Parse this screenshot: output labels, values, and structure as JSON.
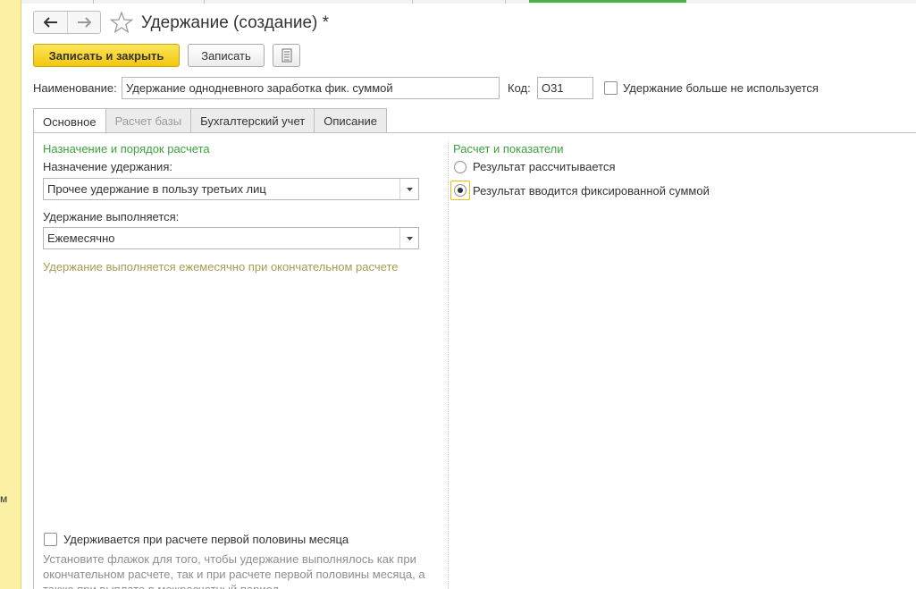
{
  "window": {
    "title": "Удержание (создание) *"
  },
  "left_strip": {
    "text": "м"
  },
  "toolbar": {
    "save_close_label": "Записать и закрыть",
    "save_label": "Записать"
  },
  "header": {
    "name_label": "Наименование:",
    "name_value": "Удержание однодневного заработка фик. суммой",
    "code_label": "Код:",
    "code_value": "О31",
    "unused_label": "Удержание больше не используется"
  },
  "tabs": [
    {
      "label": "Основное",
      "state": "active"
    },
    {
      "label": "Расчет базы",
      "state": "disabled"
    },
    {
      "label": "Бухгалтерский учет",
      "state": "normal"
    },
    {
      "label": "Описание",
      "state": "normal"
    }
  ],
  "left_panel": {
    "group_title": "Назначение и порядок расчета",
    "purpose_label": "Назначение удержания:",
    "purpose_value": "Прочее удержание в пользу третьих лиц",
    "frequency_label": "Удержание выполняется:",
    "frequency_value": "Ежемесячно",
    "frequency_hint": "Удержание выполняется ежемесячно при окончательном расчете",
    "first_half_label": "Удерживается при расчете первой половины месяца",
    "first_half_hint": "Установите флажок для того, чтобы удержание выполнялось как при окончательном расчете, так и при расчете первой половины месяца, а также при выплате в межрасчетный период"
  },
  "right_panel": {
    "group_title": "Расчет и показатели",
    "radio_calculated": "Результат рассчитывается",
    "radio_fixed": "Результат вводится фиксированной суммой",
    "selected": "fixed"
  },
  "colors": {
    "accent_green": "#3da23d",
    "primary_button": "#f3c80d",
    "hint_text": "#a99a52",
    "left_strip": "#fbf0a3"
  }
}
